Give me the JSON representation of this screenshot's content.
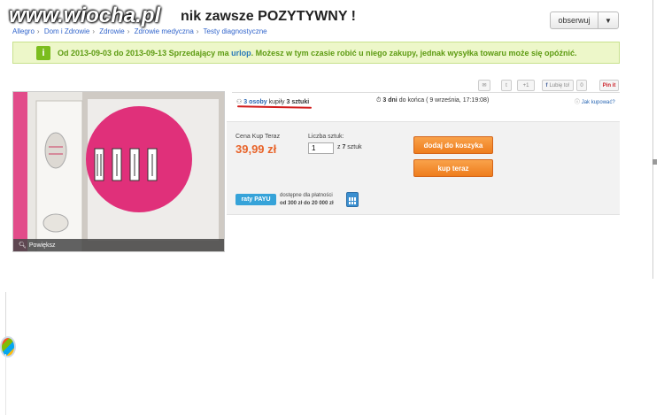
{
  "watermark": "www.wiocha.pl",
  "header": {
    "title": "N                                     nik zawsze POZYTYWNY !",
    "title_visible": "nik zawsze POZYTYWNY !",
    "observe_label": "obserwuj"
  },
  "breadcrumb": [
    "Allegro",
    "Dom i Zdrowie",
    "Zdrowie",
    "Zdrowie medyczna",
    "Testy diagnostyczne"
  ],
  "notice": {
    "text_before": "Od 2013-09-03 do 2013-09-13 Sprzedający ma ",
    "text_bold": "urlop",
    "text_after": ". Możesz w tym czasie robić u niego zakupy, jednak wysyłka towaru może się opóźnić."
  },
  "share": {
    "gplus": "+1",
    "like": "Lubię to!",
    "like_count": "0",
    "pinit": "Pin it"
  },
  "gallery": {
    "zoom_label": "Powiększ"
  },
  "buyers": {
    "count": "3 osoby",
    "verb": " kupiły ",
    "qty": "3 sztuki"
  },
  "ends": {
    "days": "3 dni",
    "rest": " do końca ( 9 września, 17:19:08)"
  },
  "how_to_buy": "Jak kupować?",
  "buy": {
    "price_label": "Cena Kup Teraz",
    "price": "39,99 zł",
    "qty_label": "Liczba sztuk:",
    "qty_value": "1",
    "qty_of_prefix": "z ",
    "qty_total": "7",
    "qty_unit": " sztuk",
    "add_to_cart": "dodaj do koszyka",
    "buy_now": "kup teraz"
  },
  "raty": {
    "logo": "raty PAYU",
    "line1": "dostępne dla płatności",
    "line2": "od 300 zł do 20 000 zł"
  },
  "colors": {
    "accent_orange": "#ee7d1d",
    "price_orange": "#e8642a",
    "notice_green": "#5d9b12",
    "link_blue": "#2a67b3"
  }
}
